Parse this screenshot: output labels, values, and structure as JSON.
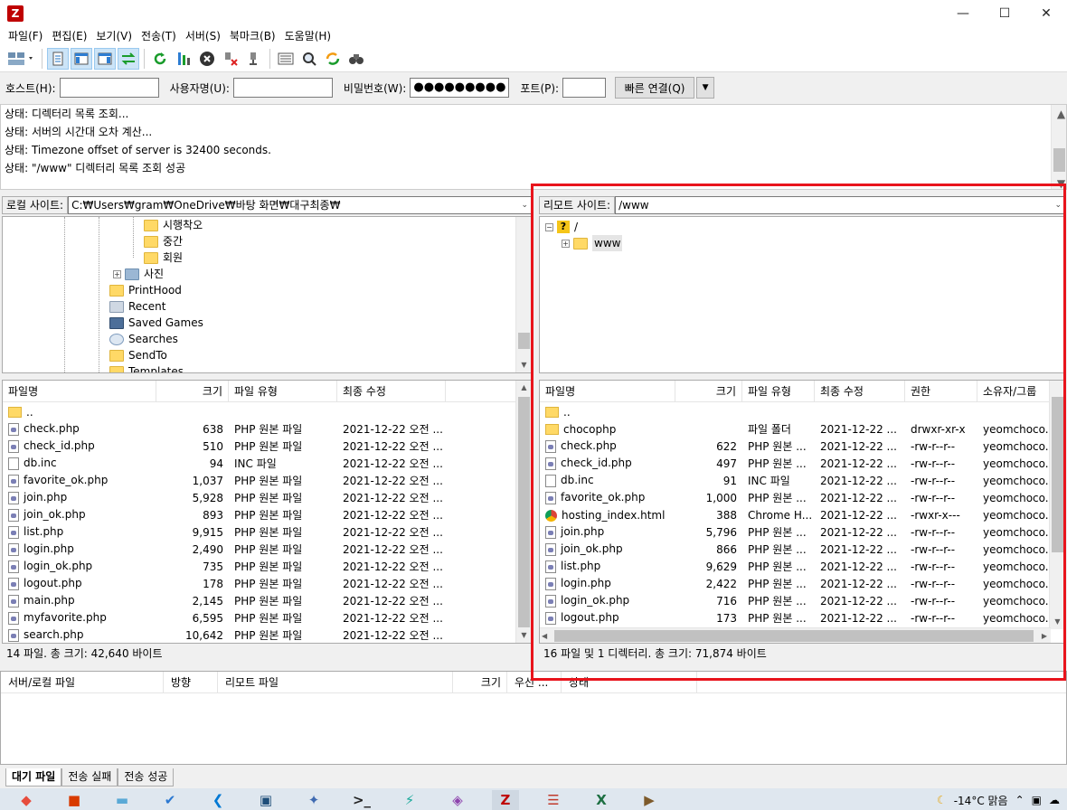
{
  "menu": [
    "파일(F)",
    "편집(E)",
    "보기(V)",
    "전송(T)",
    "서버(S)",
    "북마크(B)",
    "도움말(H)"
  ],
  "quickconnect": {
    "host_label": "호스트(H):",
    "user_label": "사용자명(U):",
    "pass_label": "비밀번호(W):",
    "pass_value": "●●●●●●●●●",
    "port_label": "포트(P):",
    "connect_button": "빠른 연결(Q)"
  },
  "log": [
    "상태: 디렉터리 목록 조회...",
    "상태: 서버의 시간대 오차 계산...",
    "상태: Timezone offset of server is 32400 seconds.",
    "상태: \"/www\" 디렉터리 목록 조회 성공"
  ],
  "local": {
    "site_label": "로컬 사이트:",
    "path": "C:₩Users₩gram₩OneDrive₩바탕 화면₩대구최종₩",
    "tree": [
      "시행착오",
      "중간",
      "회원",
      "사진",
      "PrintHood",
      "Recent",
      "Saved Games",
      "Searches",
      "SendTo",
      "Templates"
    ],
    "columns": [
      "파일명",
      "크기",
      "파일 유형",
      "최종 수정"
    ],
    "parent": "..",
    "files": [
      {
        "name": "check.php",
        "size": "638",
        "type": "PHP 원본 파일",
        "modified": "2021-12-22 오전 ..."
      },
      {
        "name": "check_id.php",
        "size": "510",
        "type": "PHP 원본 파일",
        "modified": "2021-12-22 오전 ..."
      },
      {
        "name": "db.inc",
        "size": "94",
        "type": "INC 파일",
        "modified": "2021-12-22 오전 ..."
      },
      {
        "name": "favorite_ok.php",
        "size": "1,037",
        "type": "PHP 원본 파일",
        "modified": "2021-12-22 오전 ..."
      },
      {
        "name": "join.php",
        "size": "5,928",
        "type": "PHP 원본 파일",
        "modified": "2021-12-22 오전 ..."
      },
      {
        "name": "join_ok.php",
        "size": "893",
        "type": "PHP 원본 파일",
        "modified": "2021-12-22 오전 ..."
      },
      {
        "name": "list.php",
        "size": "9,915",
        "type": "PHP 원본 파일",
        "modified": "2021-12-22 오전 ..."
      },
      {
        "name": "login.php",
        "size": "2,490",
        "type": "PHP 원본 파일",
        "modified": "2021-12-22 오전 ..."
      },
      {
        "name": "login_ok.php",
        "size": "735",
        "type": "PHP 원본 파일",
        "modified": "2021-12-22 오전 ..."
      },
      {
        "name": "logout.php",
        "size": "178",
        "type": "PHP 원본 파일",
        "modified": "2021-12-22 오전 ..."
      },
      {
        "name": "main.php",
        "size": "2,145",
        "type": "PHP 원본 파일",
        "modified": "2021-12-22 오전 ..."
      },
      {
        "name": "myfavorite.php",
        "size": "6,595",
        "type": "PHP 원본 파일",
        "modified": "2021-12-22 오전 ..."
      },
      {
        "name": "search.php",
        "size": "10,642",
        "type": "PHP 원본 파일",
        "modified": "2021-12-22 오전 ..."
      }
    ],
    "status": "14 파일. 총 크기: 42,640 바이트"
  },
  "remote": {
    "site_label": "리모트 사이트:",
    "path": "/www",
    "tree_root": "/",
    "tree_child": "www",
    "columns": [
      "파일명",
      "크기",
      "파일 유형",
      "최종 수정",
      "권한",
      "소유자/그룹"
    ],
    "parent": "..",
    "files": [
      {
        "name": "chocophp",
        "size": "",
        "type": "파일 폴더",
        "modified": "2021-12-22 ...",
        "perm": "drwxr-xr-x",
        "owner": "yeomchoco...",
        "kind": "folder"
      },
      {
        "name": "check.php",
        "size": "622",
        "type": "PHP 원본 ...",
        "modified": "2021-12-22 ...",
        "perm": "-rw-r--r--",
        "owner": "yeomchoco...",
        "kind": "php"
      },
      {
        "name": "check_id.php",
        "size": "497",
        "type": "PHP 원본 ...",
        "modified": "2021-12-22 ...",
        "perm": "-rw-r--r--",
        "owner": "yeomchoco...",
        "kind": "php"
      },
      {
        "name": "db.inc",
        "size": "91",
        "type": "INC 파일",
        "modified": "2021-12-22 ...",
        "perm": "-rw-r--r--",
        "owner": "yeomchoco...",
        "kind": "inc"
      },
      {
        "name": "favorite_ok.php",
        "size": "1,000",
        "type": "PHP 원본 ...",
        "modified": "2021-12-22 ...",
        "perm": "-rw-r--r--",
        "owner": "yeomchoco...",
        "kind": "php"
      },
      {
        "name": "hosting_index.html",
        "size": "388",
        "type": "Chrome H...",
        "modified": "2021-12-22 ...",
        "perm": "-rwxr-x---",
        "owner": "yeomchoco...",
        "kind": "html"
      },
      {
        "name": "join.php",
        "size": "5,796",
        "type": "PHP 원본 ...",
        "modified": "2021-12-22 ...",
        "perm": "-rw-r--r--",
        "owner": "yeomchoco...",
        "kind": "php"
      },
      {
        "name": "join_ok.php",
        "size": "866",
        "type": "PHP 원본 ...",
        "modified": "2021-12-22 ...",
        "perm": "-rw-r--r--",
        "owner": "yeomchoco...",
        "kind": "php"
      },
      {
        "name": "list.php",
        "size": "9,629",
        "type": "PHP 원본 ...",
        "modified": "2021-12-22 ...",
        "perm": "-rw-r--r--",
        "owner": "yeomchoco...",
        "kind": "php"
      },
      {
        "name": "login.php",
        "size": "2,422",
        "type": "PHP 원본 ...",
        "modified": "2021-12-22 ...",
        "perm": "-rw-r--r--",
        "owner": "yeomchoco...",
        "kind": "php"
      },
      {
        "name": "login_ok.php",
        "size": "716",
        "type": "PHP 원본 ...",
        "modified": "2021-12-22 ...",
        "perm": "-rw-r--r--",
        "owner": "yeomchoco...",
        "kind": "php"
      },
      {
        "name": "logout.php",
        "size": "173",
        "type": "PHP 원본 ...",
        "modified": "2021-12-22 ...",
        "perm": "-rw-r--r--",
        "owner": "yeomchoco...",
        "kind": "php"
      }
    ],
    "status": "16 파일 및 1 디렉터리. 총 크기: 71,874 바이트"
  },
  "queue": {
    "columns": [
      "서버/로컬 파일",
      "방향",
      "리모트 파일",
      "크기",
      "우선 ...",
      "상태"
    ],
    "tabs": [
      "대기 파일",
      "전송 실패",
      "전송 성공"
    ]
  },
  "taskbar": {
    "weather": "-14°C  맑음"
  },
  "colors": {
    "highlight": "#e8141c",
    "folder": "#ffd966",
    "selection": "#cce4f7"
  }
}
